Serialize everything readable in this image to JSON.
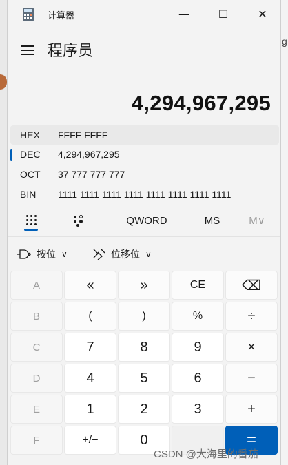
{
  "window": {
    "title": "计算器"
  },
  "titlebar": {
    "minimize": "—",
    "maximize": "☐",
    "close": "✕"
  },
  "header": {
    "mode": "程序员"
  },
  "display": {
    "value": "4,294,967,295"
  },
  "radix": [
    {
      "name": "HEX",
      "value": "FFFF FFFF"
    },
    {
      "name": "DEC",
      "value": "4,294,967,295"
    },
    {
      "name": "OCT",
      "value": "37 777 777 777"
    },
    {
      "name": "BIN",
      "value": "1111 1111 1111 1111 1111 1111 1111 1111"
    }
  ],
  "toolbar": {
    "word_size": "QWORD",
    "ms": "MS",
    "mv": "M∨"
  },
  "bitwise": {
    "bitwise_label": "按位",
    "shift_label": "位移位",
    "chevron": "∨"
  },
  "keys": {
    "A": "A",
    "lshift": "«",
    "rshift": "»",
    "ce": "CE",
    "backspace": "⌫",
    "B": "B",
    "lparen": "(",
    "rparen": ")",
    "percent": "%",
    "divide": "÷",
    "C": "C",
    "n7": "7",
    "n8": "8",
    "n9": "9",
    "multiply": "×",
    "D": "D",
    "n4": "4",
    "n5": "5",
    "n6": "6",
    "minus": "−",
    "E": "E",
    "n1": "1",
    "n2": "2",
    "n3": "3",
    "plus": "+",
    "F": "F",
    "negate": "+/−",
    "n0": "0",
    "equals": "="
  },
  "watermark": "CSDN @大海里的番茄",
  "background_right": "g",
  "colors": {
    "accent": "#005fb8",
    "background": "#f3f3f3"
  }
}
